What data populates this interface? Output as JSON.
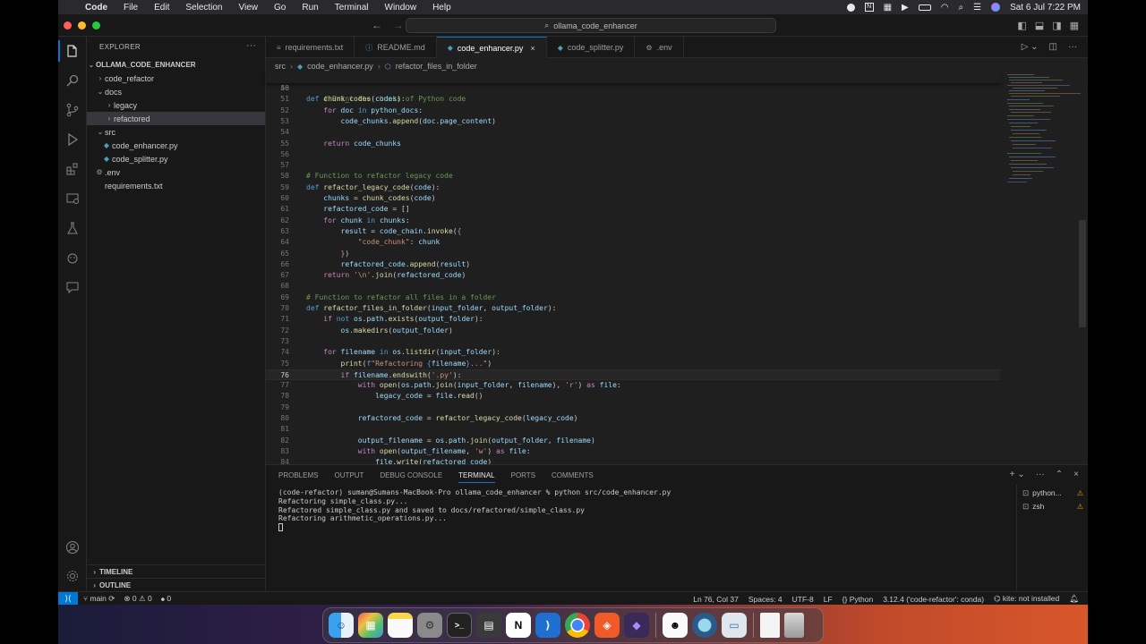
{
  "menubar": {
    "app": "Code",
    "items": [
      "File",
      "Edit",
      "Selection",
      "View",
      "Go",
      "Run",
      "Terminal",
      "Window",
      "Help"
    ],
    "datetime": "Sat 6 Jul  7:22 PM"
  },
  "titlebar": {
    "search_text": "ollama_code_enhancer"
  },
  "sidebar": {
    "title": "EXPLORER",
    "root": "OLLAMA_CODE_ENHANCER",
    "items": [
      {
        "label": "code_refactor"
      },
      {
        "label": "docs"
      },
      {
        "label": "legacy"
      },
      {
        "label": "refactored"
      },
      {
        "label": "src"
      },
      {
        "label": "code_enhancer.py"
      },
      {
        "label": "code_splitter.py"
      },
      {
        "label": ".env"
      },
      {
        "label": "requirements.txt"
      }
    ],
    "timeline": "TIMELINE",
    "outline": "OUTLINE"
  },
  "tabs": [
    {
      "label": "requirements.txt"
    },
    {
      "label": "README.md"
    },
    {
      "label": "code_enhancer.py"
    },
    {
      "label": "code_splitter.py"
    },
    {
      "label": ".env"
    }
  ],
  "breadcrumb": {
    "folder": "src",
    "file": "code_enhancer.py",
    "symbol": "refactor_files_in_folder"
  },
  "editor": {
    "sticky_line": "def chunk_codes(codes):",
    "cursor_line": "76"
  },
  "panel": {
    "tabs": [
      "PROBLEMS",
      "OUTPUT",
      "DEBUG CONSOLE",
      "TERMINAL",
      "PORTS",
      "COMMENTS"
    ],
    "terminal_lines": [
      "(code-refactor) suman@Sumans-MacBook-Pro ollama_code_enhancer % python src/code_enhancer.py",
      "Refactoring simple_class.py...",
      "Refactored simple_class.py and saved to docs/refactored/simple_class.py",
      "Refactoring arithmetic_operations.py..."
    ],
    "terminals": [
      {
        "label": "python..."
      },
      {
        "label": "zsh"
      }
    ]
  },
  "statusbar": {
    "branch": "main",
    "errors": "0",
    "warnings": "0",
    "ports": "0",
    "position": "Ln 76, Col 37",
    "spaces": "Spaces: 4",
    "encoding": "UTF-8",
    "eol": "LF",
    "language": "Python",
    "interpreter": "3.12.4 ('code-refactor': conda)",
    "kite": "kite: not installed"
  },
  "colors": {
    "accent": "#0078d4",
    "editor_bg": "#1f1f1f",
    "sidebar_bg": "#181818"
  }
}
